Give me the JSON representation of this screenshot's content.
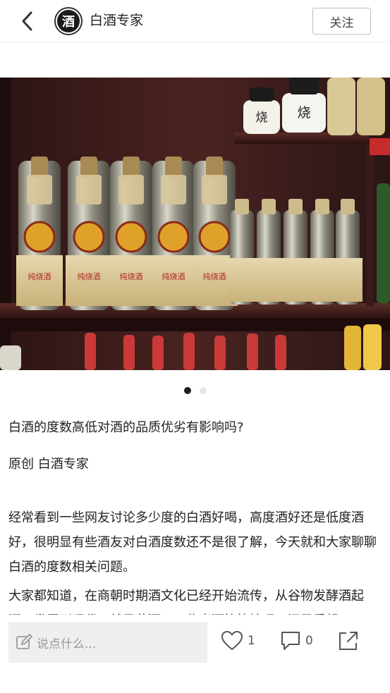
{
  "header": {
    "avatar_text": "酒",
    "account_name": "白酒专家",
    "follow_label": "关注"
  },
  "carousel": {
    "slide_count": 2,
    "active_index": 0,
    "bottle_label_text": "纯烧酒",
    "jar_label_text": "烧"
  },
  "article": {
    "title": "白酒的度数高低对酒的品质优劣有影响吗?",
    "byline": "原创 白酒专家",
    "paragraphs": [
      "经常看到一些网友讨论多少度的白酒好喝，高度酒好还是低度酒好，很明显有些酒友对白酒度数还不是很了解，今天就和大家聊聊白酒的度数相关问题。",
      "大家都知道，在商朝时期酒文化已经开始流传，从谷物发酵酒起源，发展到现代，就是黄酒、一些米酒等等情况，还是看起"
    ]
  },
  "bottom_bar": {
    "comment_placeholder": "说点什么...",
    "like_count": "1",
    "comment_count": "0"
  }
}
